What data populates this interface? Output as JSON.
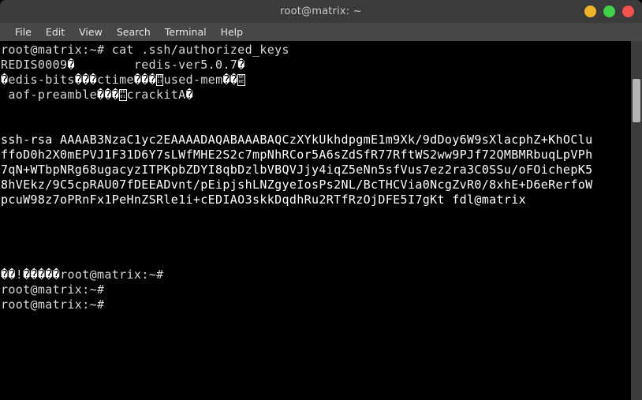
{
  "window": {
    "title": "root@matrix: ~",
    "buttons": [
      {
        "name": "minimize-button",
        "color": "#f0b429"
      },
      {
        "name": "maximize-button",
        "color": "#3fd34a"
      },
      {
        "name": "close-button",
        "color": "#f4524d"
      }
    ],
    "titlebar_bg": "#3b3b3b",
    "menubar_bg": "#474747",
    "terminal_bg": "#000000",
    "terminal_fg": "#d8d8d8"
  },
  "menubar": {
    "items": [
      {
        "label": "File"
      },
      {
        "label": "Edit"
      },
      {
        "label": "View"
      },
      {
        "label": "Search"
      },
      {
        "label": "Terminal"
      },
      {
        "label": "Help"
      }
    ]
  },
  "terminal": {
    "command_line": "root@matrix:~# cat .ssh/authorized_keys",
    "redis_line_pre": "REDIS0009",
    "redis_line_mid": "        redis-ver5.0.7",
    "line_redis_bits_a": "edis-bits",
    "line_redis_bits_b": "ctime",
    "line_redis_bits_c": "used-mem",
    "line_aof_a": " aof-preamble",
    "line_aof_b": "crackitA",
    "ssh_key_lines": [
      "ssh-rsa AAAAB3NzaC1yc2EAAAADAQABAAABAQCzXYkUkhdpgmE1m9Xk/9dDoy6W9sXlacphZ+KhOClu",
      "ffoD0h2X0mEPVJ1F31D6Y7sLWfMHE2S2c7mpNhRCor5A6sZdSfR77RftWS2ww9PJf72QMBMRbuqLpVPh",
      "7qN+WTbpNRg68ugacyzITPKpbZDYI8qbDzlbVBQVJjy4iqZ5eNn5sfVus7ez2ra3C0SSu/oFOichepK5",
      "8hVEkz/9C5cpRAU07fDEEADvnt/pEipjshLNZgyeIosPs2NL/BcTHCVia0NcgZvR0/8xhE+D6eRerfoW",
      "pcuW98z7oPRnFx1PeHnZSRle1i+cEDIAO3skkDqdhRu2RTfRzOjDFE5I7gKt fdl@matrix"
    ],
    "tail_garbled_prefix": "!",
    "prompt_after_garble": "root@matrix:~#",
    "prompt_lines": [
      "root@matrix:~#",
      "root@matrix:~#"
    ]
  },
  "scrollbar": {
    "track_color": "#3c3c3c",
    "thumb_color": "#b3b3b3"
  }
}
